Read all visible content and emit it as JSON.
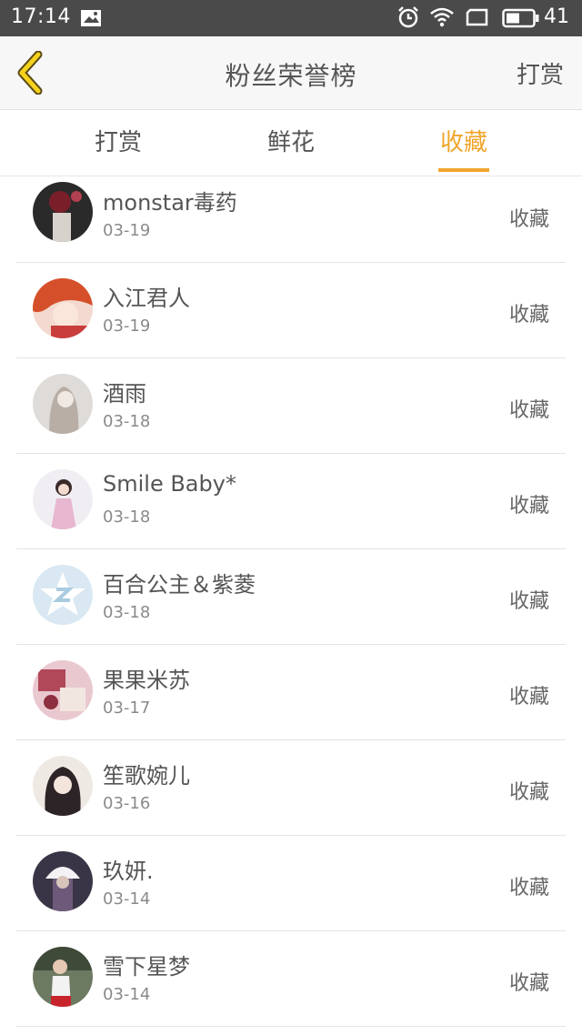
{
  "status_bar": {
    "time": "17:14",
    "battery": "41",
    "icons": [
      "image-icon",
      "alarm-icon",
      "wifi-icon",
      "screen-icon",
      "battery-icon"
    ]
  },
  "header": {
    "title": "粉丝荣誉榜",
    "action_label": "打赏",
    "back_icon": "chevron-left-icon"
  },
  "tabs": [
    {
      "label": "打赏",
      "active": false
    },
    {
      "label": "鲜花",
      "active": false
    },
    {
      "label": "收藏",
      "active": true
    }
  ],
  "accent_color": "#f0a52b",
  "list": [
    {
      "name": "monstar毒药",
      "date": "03-19",
      "action": "收藏"
    },
    {
      "name": "入江君人",
      "date": "03-19",
      "action": "收藏"
    },
    {
      "name": "酒雨",
      "date": "03-18",
      "action": "收藏"
    },
    {
      "name": "Smile Baby*",
      "date": "03-18",
      "action": "收藏"
    },
    {
      "name": "百合公主＆紫菱",
      "date": "03-18",
      "action": "收藏"
    },
    {
      "name": "果果米苏",
      "date": "03-17",
      "action": "收藏"
    },
    {
      "name": "笙歌婉儿",
      "date": "03-16",
      "action": "收藏"
    },
    {
      "name": "玖妍.",
      "date": "03-14",
      "action": "收藏"
    },
    {
      "name": "雪下星梦",
      "date": "03-14",
      "action": "收藏"
    }
  ]
}
